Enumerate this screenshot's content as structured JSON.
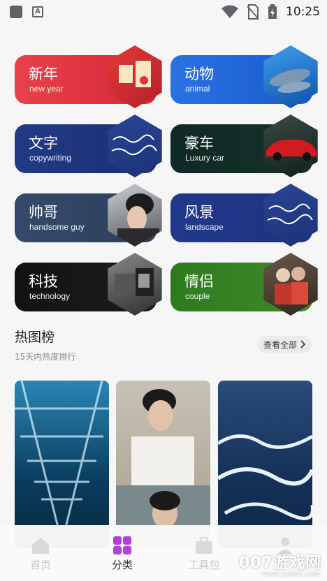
{
  "status_bar": {
    "time": "10:25"
  },
  "categories": [
    {
      "title": "新年",
      "subtitle": "new year"
    },
    {
      "title": "动物",
      "subtitle": "animal"
    },
    {
      "title": "文字",
      "subtitle": "copywriting"
    },
    {
      "title": "豪车",
      "subtitle": "Luxury car"
    },
    {
      "title": "帅哥",
      "subtitle": "handsome guy"
    },
    {
      "title": "风景",
      "subtitle": "landscape"
    },
    {
      "title": "科技",
      "subtitle": "technology"
    },
    {
      "title": "情侣",
      "subtitle": "couple"
    }
  ],
  "hot": {
    "title": "热图榜",
    "subtitle": "15天内热度排行",
    "see_all": "查看全部"
  },
  "tabs": [
    {
      "label": "首页"
    },
    {
      "label": "分类"
    },
    {
      "label": "工具包"
    }
  ],
  "watermark": {
    "text": "007游戏网",
    "url": "www.yx007.com"
  },
  "colors": {
    "accent": "#b23fd6",
    "red_card": "#e2323a",
    "blue_card": "#1f6fe0"
  }
}
